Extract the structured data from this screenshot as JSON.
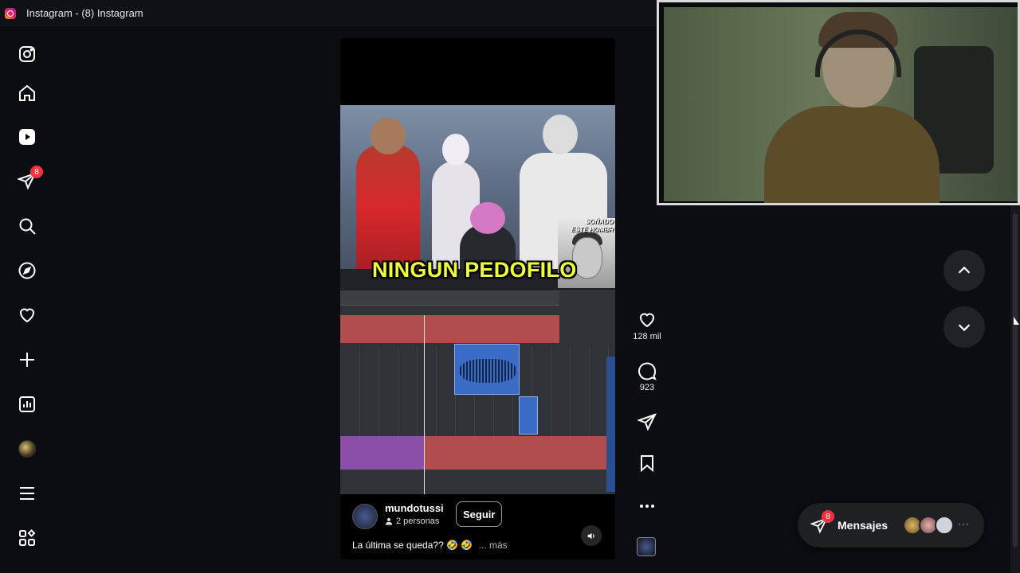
{
  "window": {
    "title": "Instagram - (8) Instagram",
    "icon": "instagram-icon"
  },
  "sidebar": {
    "items": [
      {
        "name": "instagram-logo",
        "icon": "instagram-icon"
      },
      {
        "name": "home",
        "icon": "home-icon"
      },
      {
        "name": "reels",
        "icon": "reels-icon"
      },
      {
        "name": "messages",
        "icon": "paper-plane-icon",
        "badge": "8"
      },
      {
        "name": "search",
        "icon": "search-icon"
      },
      {
        "name": "explore",
        "icon": "compass-icon"
      },
      {
        "name": "notifications",
        "icon": "heart-icon"
      },
      {
        "name": "create",
        "icon": "plus-icon"
      },
      {
        "name": "dashboard",
        "icon": "chart-icon"
      },
      {
        "name": "profile",
        "icon": "avatar-icon"
      },
      {
        "name": "more",
        "icon": "menu-icon"
      },
      {
        "name": "also-from-meta",
        "icon": "grid-icon"
      }
    ]
  },
  "reel": {
    "overlay_text": "NINGUN PEDOFILO",
    "inset_label_line1": "SOÑADO",
    "inset_label_line2": "ESTE HOMBR",
    "author": {
      "username": "mundotussi",
      "people": "2 personas"
    },
    "follow_label": "Seguir",
    "caption": "La última se queda?? 🤣 🤣",
    "more_label": "... más"
  },
  "actions": {
    "likes": "128 mil",
    "comments": "923"
  },
  "messages_pill": {
    "label": "Mensajes",
    "badge": "8"
  },
  "colors": {
    "background": "#0b0d12",
    "badge": "#ff3040",
    "overlay_text": "#f0ff3c"
  }
}
